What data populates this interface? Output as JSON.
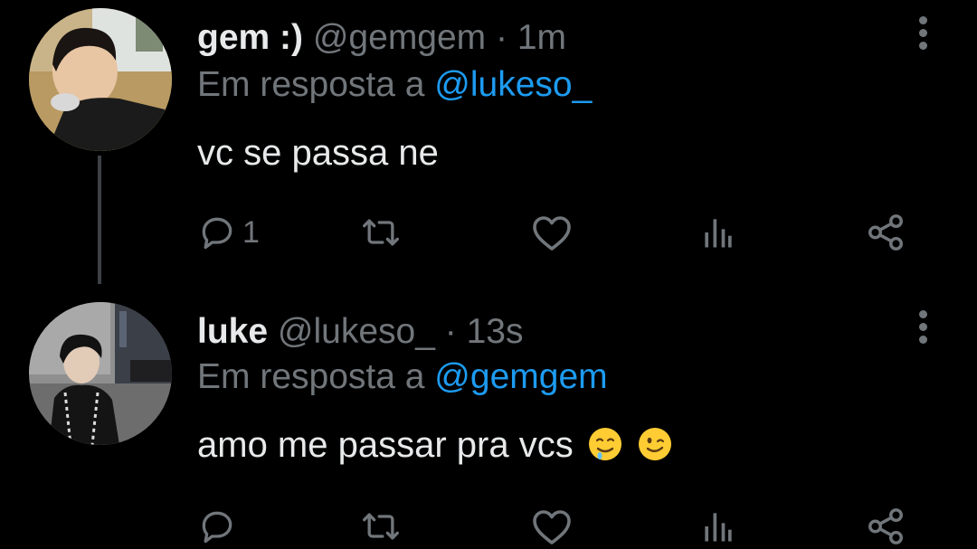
{
  "colors": {
    "background": "#000000",
    "text": "#e7e9ea",
    "muted": "#71767b",
    "mention": "#1d9bf0",
    "thread_line": "#3d4145"
  },
  "tweets": [
    {
      "name": "gem :)",
      "handle": "@gemgem",
      "separator": "·",
      "time": "1m",
      "reply_prefix": "Em resposta a",
      "reply_mention": "@lukeso_",
      "text": "vc se passa ne",
      "emojis": [],
      "reply_count": "1",
      "icons": [
        "reply-icon",
        "retweet-icon",
        "like-icon",
        "stats-icon",
        "share-icon",
        "more-icon"
      ]
    },
    {
      "name": "luke",
      "handle": "@lukeso_",
      "separator": "·",
      "time": "13s",
      "reply_prefix": "Em resposta a",
      "reply_mention": "@gemgem",
      "text": "amo me passar pra vcs",
      "emojis": [
        "drooling-face-emoji",
        "winking-face-emoji"
      ],
      "reply_count": "",
      "icons": [
        "reply-icon",
        "retweet-icon",
        "like-icon",
        "stats-icon",
        "share-icon",
        "more-icon"
      ]
    }
  ]
}
